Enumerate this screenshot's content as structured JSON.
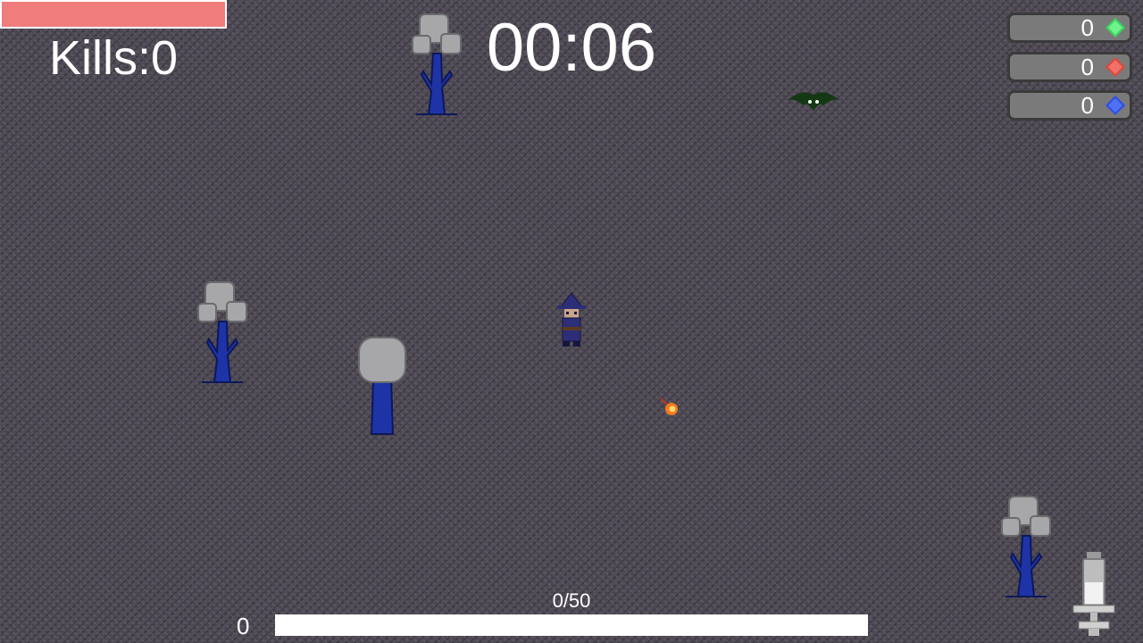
{
  "hud": {
    "kills": "Kills:0",
    "timer": "00:06",
    "gems": [
      {
        "count": "0",
        "color": "#3bd35a",
        "icon": "green-gem-icon"
      },
      {
        "count": "0",
        "color": "#e0463d",
        "icon": "red-gem-icon"
      },
      {
        "count": "0",
        "color": "#2d4fe3",
        "icon": "blue-gem-icon"
      }
    ],
    "xp_text": "0/50",
    "level": "0",
    "health_fill": 1.0,
    "xp_fill": 0.0
  },
  "colors": {
    "health": "#f07c7c",
    "tree_trunk": "#1e33a6",
    "tree_top": "#a7a7aa",
    "bat": "#143814",
    "wizard": "#2c2e77",
    "fireball": "#f37a1e"
  }
}
